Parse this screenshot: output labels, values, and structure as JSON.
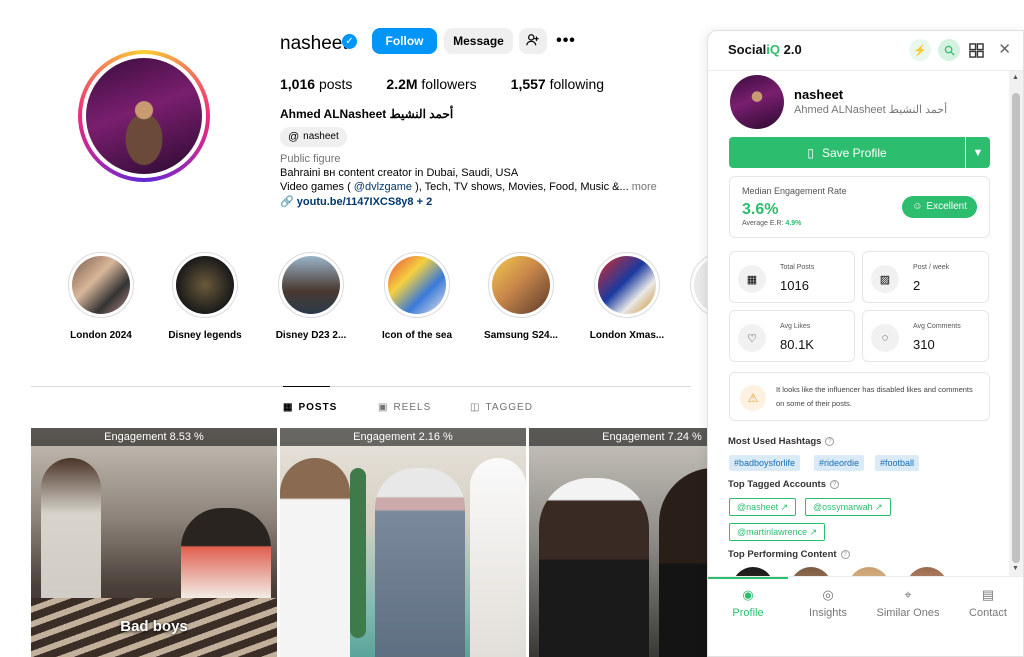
{
  "profile": {
    "username": "nasheet",
    "follow_label": "Follow",
    "message_label": "Message",
    "more_label": "•••",
    "posts": "1,016",
    "posts_label": "posts",
    "followers": "2.2M",
    "followers_label": "followers",
    "following": "1,557",
    "following_label": "following",
    "full_name": "Ahmed ALNasheet أحمد النشيط",
    "threads_handle": "nasheet",
    "category": "Public figure",
    "bio_line1": "Bahraini вн content creator in Dubai, Saudi, USA",
    "bio_line2_prefix": "Video games ( ",
    "bio_line2_mention": "@dvlzgame",
    "bio_line2_suffix": " ), Tech, TV shows, Movies, Food, Music &...",
    "bio_more": "more",
    "link": "youtu.be/1147IXCS8y8 + 2"
  },
  "highlights": [
    {
      "label": "London 2024"
    },
    {
      "label": "Disney legends"
    },
    {
      "label": "Disney D23 2..."
    },
    {
      "label": "Icon of the sea"
    },
    {
      "label": "Samsung S24..."
    },
    {
      "label": "London Xmas..."
    }
  ],
  "tabs": {
    "posts": "POSTS",
    "reels": "REELS",
    "tagged": "TAGGED"
  },
  "posts": [
    {
      "engagement": "Engagement 8.53 %",
      "caption": "Bad boys"
    },
    {
      "engagement": "Engagement 2.16 %",
      "caption": ""
    },
    {
      "engagement": "Engagement 7.24 %",
      "caption": ""
    }
  ],
  "panel": {
    "brand_prefix": "Social",
    "brand_iq": "iQ",
    "brand_version": " 2.0",
    "name": "nasheet",
    "sub": "Ahmed ALNasheet أحمد النشيط",
    "save_label": "Save Profile",
    "er_label": "Median Engagement Rate",
    "er_value": "3.6%",
    "er_avg_label": "Average E.R: ",
    "er_avg_value": "4.9%",
    "er_badge": "Excellent",
    "metrics": [
      {
        "label": "Total Posts",
        "value": "1016",
        "icon": "calendar-icon"
      },
      {
        "label": "Post / week",
        "value": "2",
        "icon": "image-icon"
      },
      {
        "label": "Avg Likes",
        "value": "80.1K",
        "icon": "heart-icon"
      },
      {
        "label": "Avg Comments",
        "value": "310",
        "icon": "comment-icon"
      }
    ],
    "note": "It looks like the influencer has disabled likes and comments on some of their posts.",
    "hashtags_title": "Most Used Hashtags",
    "hashtags": [
      "#badboysforlife",
      "#rideordie",
      "#football"
    ],
    "tagged_title": "Top Tagged Accounts",
    "tagged": [
      "@nasheet ↗",
      "@ossymarwah ↗",
      "@martinlawrence ↗"
    ],
    "top_content_title": "Top Performing Content",
    "nav": [
      {
        "label": "Profile",
        "icon": "profile-icon"
      },
      {
        "label": "Insights",
        "icon": "bulb-icon"
      },
      {
        "label": "Similar Ones",
        "icon": "similar-icon"
      },
      {
        "label": "Contact",
        "icon": "contact-icon"
      }
    ]
  }
}
